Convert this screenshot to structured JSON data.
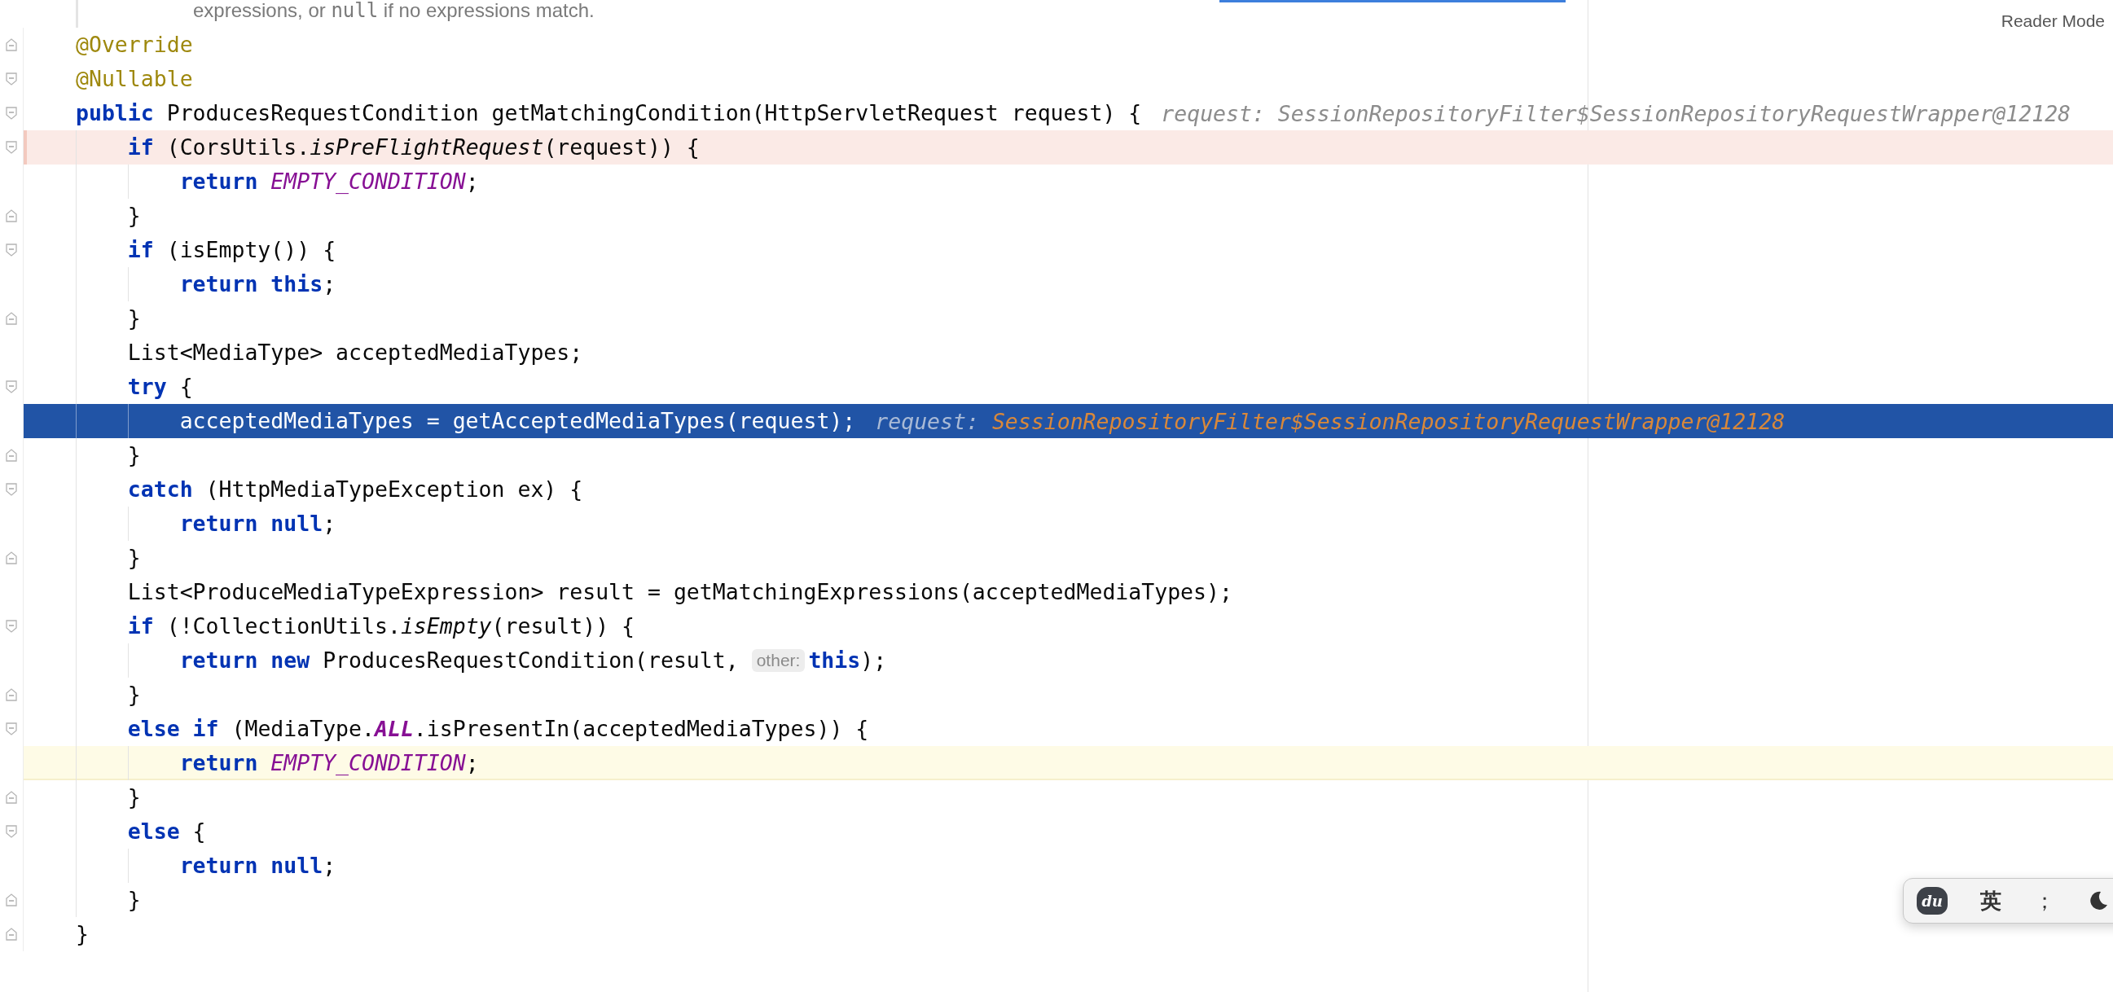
{
  "doc_comment": [
    {
      "kind": "text",
      "text": "expressions, or "
    },
    {
      "kind": "code",
      "text": "null"
    },
    {
      "kind": "text",
      "text": " if no expressions match."
    }
  ],
  "reader_mode": "Reader Mode",
  "lines": [
    {
      "kind": "block_end",
      "selected": false,
      "breakpoint": false,
      "caret": false,
      "tokens": [
        {
          "kind": "annotation",
          "text": "@Override"
        }
      ]
    },
    {
      "kind": "block_start",
      "selected": false,
      "breakpoint": false,
      "caret": false,
      "tokens": [
        {
          "kind": "annotation",
          "text": "@Nullable"
        }
      ]
    },
    {
      "kind": "block_start",
      "selected": false,
      "breakpoint": false,
      "caret": false,
      "tokens": [
        {
          "kind": "keyword",
          "text": "public"
        },
        {
          "kind": "plain",
          "text": " ProducesRequestCondition getMatchingCondition(HttpServletRequest request) {"
        },
        {
          "kind": "hint",
          "text": "request: SessionRepositoryFilter$SessionRepositoryRequestWrapper@12128"
        }
      ],
      "children": [
        {
          "kind": "block_start",
          "selected": false,
          "breakpoint": true,
          "caret": false,
          "tokens": [
            {
              "kind": "keyword",
              "text": "if"
            },
            {
              "kind": "plain",
              "text": " (CorsUtils."
            },
            {
              "kind": "static",
              "text": "isPreFlightRequest"
            },
            {
              "kind": "plain",
              "text": "(request)) {"
            }
          ],
          "children": [
            {
              "selected": false,
              "breakpoint": false,
              "caret": false,
              "tokens": [
                {
                  "kind": "keyword",
                  "text": "return"
                },
                {
                  "kind": "constant",
                  "text": " EMPTY_CONDITION"
                },
                {
                  "kind": "plain",
                  "text": ";"
                }
              ]
            }
          ]
        },
        {
          "kind": "block_end",
          "selected": false,
          "breakpoint": false,
          "caret": false,
          "tokens": [
            {
              "kind": "plain",
              "text": "}"
            }
          ]
        },
        {
          "kind": "block_start",
          "selected": false,
          "breakpoint": false,
          "caret": false,
          "tokens": [
            {
              "kind": "keyword",
              "text": "if"
            },
            {
              "kind": "plain",
              "text": " (isEmpty()) {"
            }
          ],
          "children": [
            {
              "selected": false,
              "breakpoint": false,
              "caret": false,
              "tokens": [
                {
                  "kind": "keyword",
                  "text": "return"
                },
                {
                  "kind": "keyword",
                  "text": " this"
                },
                {
                  "kind": "plain",
                  "text": ";"
                }
              ]
            }
          ]
        },
        {
          "kind": "block_end",
          "selected": false,
          "breakpoint": false,
          "caret": false,
          "tokens": [
            {
              "kind": "plain",
              "text": "}"
            }
          ]
        },
        {
          "selected": false,
          "breakpoint": false,
          "caret": false,
          "tokens": [
            {
              "kind": "plain",
              "text": "List<MediaType> acceptedMediaTypes;"
            }
          ]
        },
        {
          "kind": "block_start",
          "selected": false,
          "breakpoint": false,
          "caret": false,
          "tokens": [
            {
              "kind": "keyword",
              "text": "try"
            },
            {
              "kind": "plain",
              "text": " {"
            }
          ],
          "children": [
            {
              "selected": true,
              "breakpoint": false,
              "caret": false,
              "tokens": [
                {
                  "kind": "plain",
                  "text": "acceptedMediaTypes = getAcceptedMediaTypes(request);"
                },
                {
                  "kind": "hint",
                  "text": "request:"
                },
                {
                  "kind": "hint_value",
                  "text": "SessionRepositoryFilter$SessionRepositoryRequestWrapper@12128"
                }
              ]
            }
          ]
        },
        {
          "kind": "block_end",
          "selected": false,
          "breakpoint": false,
          "caret": false,
          "tokens": [
            {
              "kind": "plain",
              "text": "}"
            }
          ]
        },
        {
          "kind": "block_start",
          "selected": false,
          "breakpoint": false,
          "caret": false,
          "tokens": [
            {
              "kind": "keyword",
              "text": "catch"
            },
            {
              "kind": "plain",
              "text": " (HttpMediaTypeException ex) {"
            }
          ],
          "children": [
            {
              "selected": false,
              "breakpoint": false,
              "caret": false,
              "tokens": [
                {
                  "kind": "keyword",
                  "text": "return"
                },
                {
                  "kind": "keyword",
                  "text": " null"
                },
                {
                  "kind": "plain",
                  "text": ";"
                }
              ]
            }
          ]
        },
        {
          "kind": "block_end",
          "selected": false,
          "breakpoint": false,
          "caret": false,
          "tokens": [
            {
              "kind": "plain",
              "text": "}"
            }
          ]
        },
        {
          "selected": false,
          "breakpoint": false,
          "caret": false,
          "tokens": [
            {
              "kind": "plain",
              "text": "List<ProduceMediaTypeExpression> result = getMatchingExpressions(acceptedMediaTypes);"
            }
          ]
        },
        {
          "kind": "block_start",
          "selected": false,
          "breakpoint": false,
          "caret": false,
          "tokens": [
            {
              "kind": "keyword",
              "text": "if"
            },
            {
              "kind": "plain",
              "text": " (!CollectionUtils."
            },
            {
              "kind": "static",
              "text": "isEmpty"
            },
            {
              "kind": "plain",
              "text": "(result)) {"
            }
          ],
          "children": [
            {
              "selected": false,
              "breakpoint": false,
              "caret": false,
              "tokens": [
                {
                  "kind": "keyword",
                  "text": "return"
                },
                {
                  "kind": "keyword",
                  "text": " new"
                },
                {
                  "kind": "plain",
                  "text": " ProducesRequestCondition(result,"
                },
                {
                  "kind": "param_hint",
                  "text": "other:"
                },
                {
                  "kind": "keyword",
                  "text": "this"
                },
                {
                  "kind": "plain",
                  "text": ");"
                }
              ]
            }
          ]
        },
        {
          "kind": "block_end",
          "selected": false,
          "breakpoint": false,
          "caret": false,
          "tokens": [
            {
              "kind": "plain",
              "text": "}"
            }
          ]
        },
        {
          "kind": "block_start",
          "selected": false,
          "breakpoint": false,
          "caret": false,
          "tokens": [
            {
              "kind": "keyword",
              "text": "else"
            },
            {
              "kind": "keyword",
              "text": " if"
            },
            {
              "kind": "plain",
              "text": " (MediaType."
            },
            {
              "kind": "constant_bold",
              "text": "ALL"
            },
            {
              "kind": "plain",
              "text": ".isPresentIn(acceptedMediaTypes)) {"
            }
          ],
          "children": [
            {
              "selected": false,
              "breakpoint": false,
              "caret": true,
              "tokens": [
                {
                  "kind": "keyword",
                  "text": "return"
                },
                {
                  "kind": "constant",
                  "text": " EMPTY_CONDITION"
                },
                {
                  "kind": "plain",
                  "text": ";"
                }
              ]
            }
          ]
        },
        {
          "kind": "block_end",
          "selected": false,
          "breakpoint": false,
          "caret": false,
          "tokens": [
            {
              "kind": "plain",
              "text": "}"
            }
          ]
        },
        {
          "kind": "block_start",
          "selected": false,
          "breakpoint": false,
          "caret": false,
          "tokens": [
            {
              "kind": "keyword",
              "text": "else"
            },
            {
              "kind": "plain",
              "text": " {"
            }
          ],
          "children": [
            {
              "selected": false,
              "breakpoint": false,
              "caret": false,
              "tokens": [
                {
                  "kind": "keyword",
                  "text": "return"
                },
                {
                  "kind": "keyword",
                  "text": " null"
                },
                {
                  "kind": "plain",
                  "text": ";"
                }
              ]
            }
          ]
        },
        {
          "kind": "block_end",
          "selected": false,
          "breakpoint": false,
          "caret": false,
          "tokens": [
            {
              "kind": "plain",
              "text": "}"
            }
          ]
        }
      ]
    },
    {
      "kind": "block_end",
      "selected": false,
      "breakpoint": false,
      "caret": false,
      "tokens": [
        {
          "kind": "plain",
          "text": "}"
        }
      ]
    }
  ],
  "ime": {
    "logo": "du",
    "mode": "英",
    "punctuation": "；"
  }
}
